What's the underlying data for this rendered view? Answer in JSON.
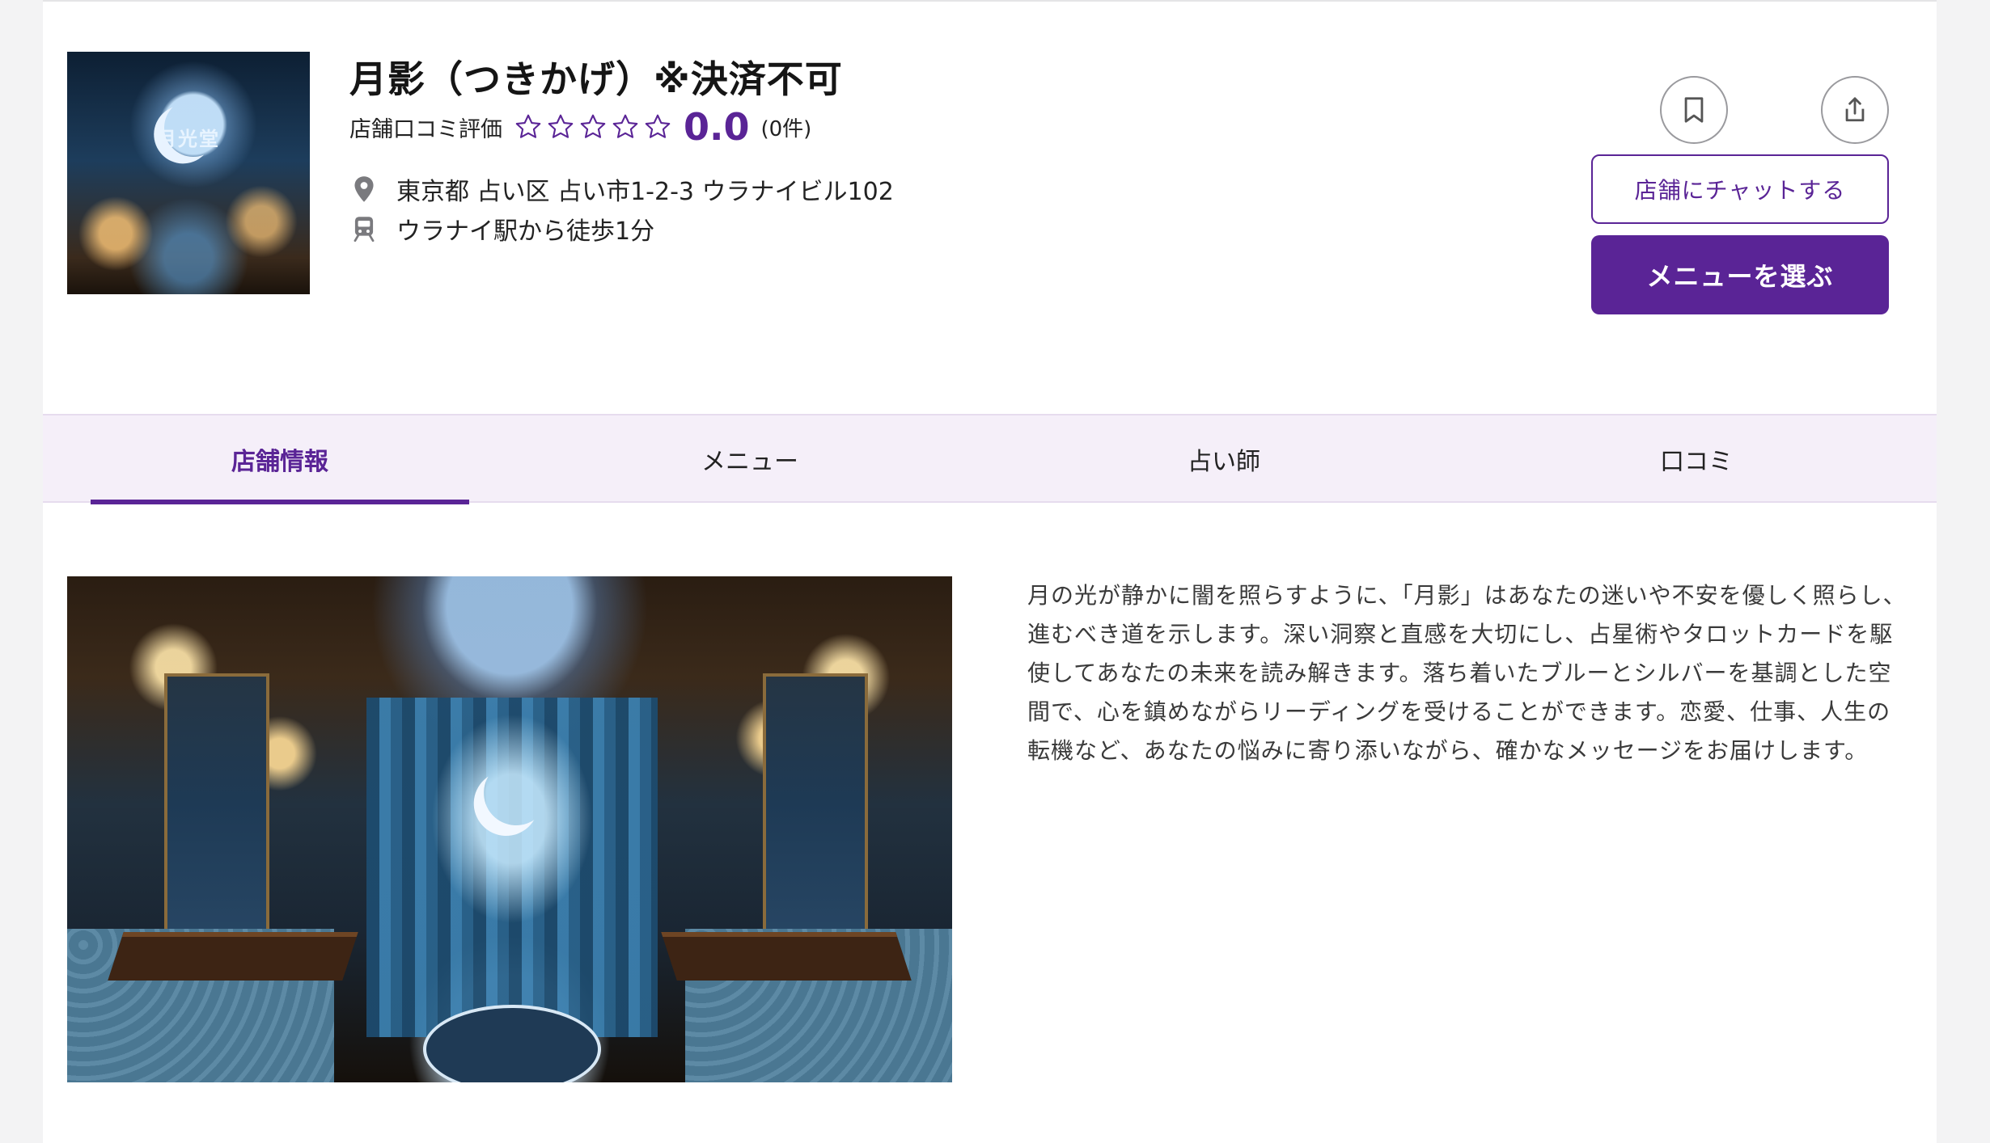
{
  "shop": {
    "name": "月影（つきかげ）※決済不可",
    "thumbnail_sign": "月光堂",
    "rating_label": "店舗口コミ評価",
    "rating_value": "0.0",
    "rating_count": "(0件)",
    "stars_filled": 0,
    "stars_total": 5,
    "address": "東京都 占い区 占い市1-2-3 ウラナイビル102",
    "access": "ウラナイ駅から徒歩1分",
    "icons": {
      "location": "location-pin-icon",
      "access": "train-icon",
      "bookmark": "bookmark-icon",
      "share": "share-icon"
    }
  },
  "actions": {
    "chat_label": "店舗にチャットする",
    "menu_label": "メニューを選ぶ"
  },
  "tabs": [
    {
      "label": "店舗情報",
      "active": true
    },
    {
      "label": "メニュー",
      "active": false
    },
    {
      "label": "占い師",
      "active": false
    },
    {
      "label": "口コミ",
      "active": false
    }
  ],
  "description": "月の光が静かに闇を照らすように、「月影」はあなたの迷いや不安を優しく照らし、進むべき道を示します。深い洞察と直感を大切にし、占星術やタロットカードを駆使してあなたの未来を読み解きます。落ち着いたブルーとシルバーを基調とした空間で、心を鎮めながらリーディングを受けることができます。恋愛、仕事、人生の転機など、あなたの悩みに寄り添いながら、確かなメッセージをお届けします。",
  "colors": {
    "accent": "#5a2496",
    "tab_bg": "#f5eff9",
    "page_bg": "#f3f3f4"
  }
}
